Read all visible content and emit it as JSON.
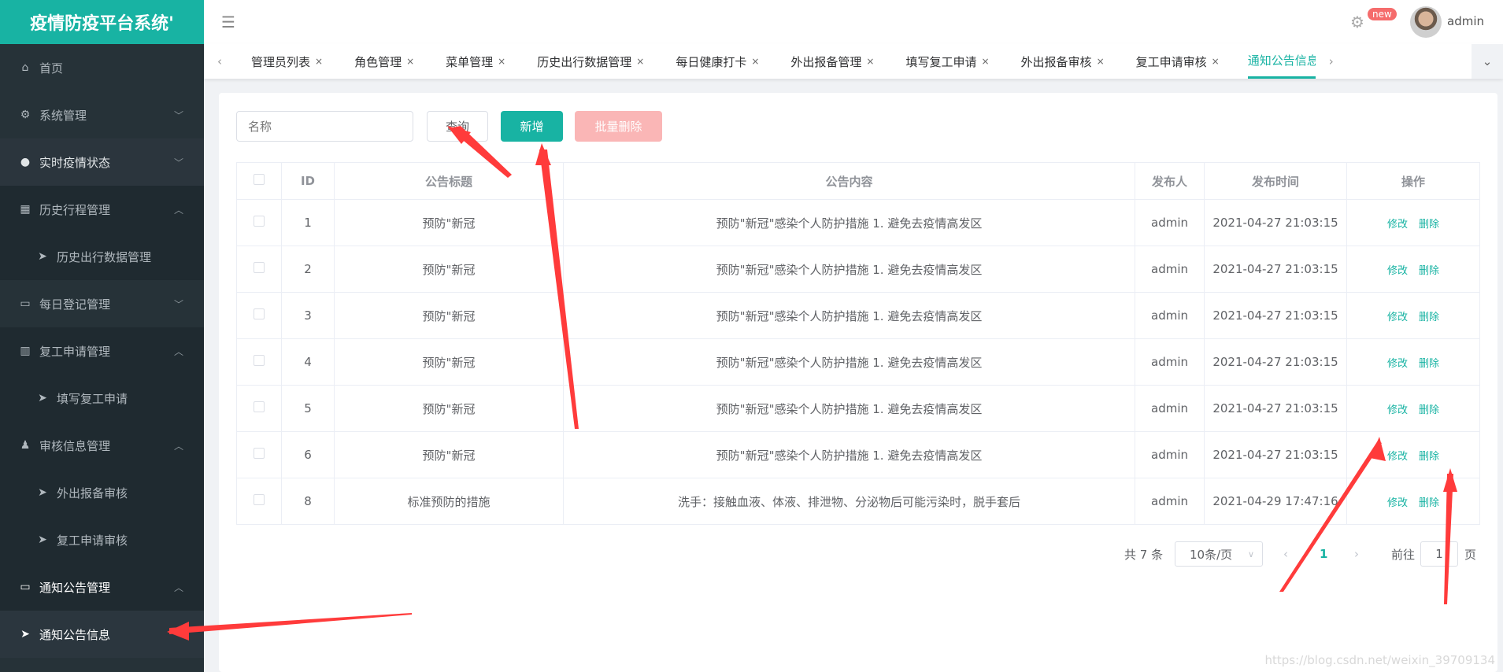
{
  "app": {
    "title": "疫情防疫平台系统'"
  },
  "header": {
    "badge": "new",
    "username": "admin"
  },
  "sidebar": {
    "items": [
      {
        "label": "首页",
        "icon": "⌂",
        "type": "top"
      },
      {
        "label": "系统管理",
        "icon": "⚙",
        "type": "top",
        "arrow": "﹀"
      },
      {
        "label": "实时疫情状态",
        "icon": "●",
        "type": "hover",
        "arrow": "﹀"
      },
      {
        "label": "历史行程管理",
        "icon": "▦",
        "type": "open",
        "arrow": "︿"
      },
      {
        "label": "历史出行数据管理",
        "icon": "➤",
        "type": "sub"
      },
      {
        "label": "每日登记管理",
        "icon": "▭",
        "type": "top",
        "arrow": "﹀"
      },
      {
        "label": "复工申请管理",
        "icon": "▥",
        "type": "open",
        "arrow": "︿"
      },
      {
        "label": "填写复工申请",
        "icon": "➤",
        "type": "sub"
      },
      {
        "label": "审核信息管理",
        "icon": "♟",
        "type": "open",
        "arrow": "︿"
      },
      {
        "label": "外出报备审核",
        "icon": "➤",
        "type": "sub"
      },
      {
        "label": "复工申请审核",
        "icon": "➤",
        "type": "sub"
      },
      {
        "label": "通知公告管理",
        "icon": "▭",
        "type": "activep",
        "arrow": "︿"
      },
      {
        "label": "通知公告信息",
        "icon": "➤",
        "type": "active"
      }
    ]
  },
  "tabs": {
    "items": [
      "管理员列表",
      "角色管理",
      "菜单管理",
      "历史出行数据管理",
      "每日健康打卡",
      "外出报备管理",
      "填写复工申请",
      "外出报备审核",
      "复工申请审核"
    ],
    "active": "通知公告信息",
    "close": "×"
  },
  "toolbar": {
    "search_placeholder": "名称",
    "query": "查询",
    "add": "新增",
    "batch_delete": "批量删除"
  },
  "table": {
    "headers": [
      "ID",
      "公告标题",
      "公告内容",
      "发布人",
      "发布时间",
      "操作"
    ],
    "rows": [
      [
        "1",
        "预防\"新冠",
        "预防\"新冠\"感染个人防护措施 1. 避免去疫情高发区",
        "admin",
        "2021-04-27 21:03:15"
      ],
      [
        "2",
        "预防\"新冠",
        "预防\"新冠\"感染个人防护措施 1. 避免去疫情高发区",
        "admin",
        "2021-04-27 21:03:15"
      ],
      [
        "3",
        "预防\"新冠",
        "预防\"新冠\"感染个人防护措施 1. 避免去疫情高发区",
        "admin",
        "2021-04-27 21:03:15"
      ],
      [
        "4",
        "预防\"新冠",
        "预防\"新冠\"感染个人防护措施 1. 避免去疫情高发区",
        "admin",
        "2021-04-27 21:03:15"
      ],
      [
        "5",
        "预防\"新冠",
        "预防\"新冠\"感染个人防护措施 1. 避免去疫情高发区",
        "admin",
        "2021-04-27 21:03:15"
      ],
      [
        "6",
        "预防\"新冠",
        "预防\"新冠\"感染个人防护措施 1. 避免去疫情高发区",
        "admin",
        "2021-04-27 21:03:15"
      ],
      [
        "8",
        "标准预防的措施",
        "洗手：接触血液、体液、排泄物、分泌物后可能污染时，脱手套后",
        "admin",
        "2021-04-29 17:47:16"
      ]
    ],
    "edit": "修改",
    "delete": "删除"
  },
  "pagination": {
    "total": "共 7 条",
    "page_size": "10条/页",
    "current": "1",
    "goto_label": "前往",
    "goto_value": "1",
    "page_suffix": "页"
  },
  "watermark": "https://blog.csdn.net/weixin_39709134",
  "colors": {
    "accent": "#18b3a3",
    "danger_light": "#fab6b6",
    "sidebar": "#263238",
    "annotation": "#ff3b3b"
  }
}
